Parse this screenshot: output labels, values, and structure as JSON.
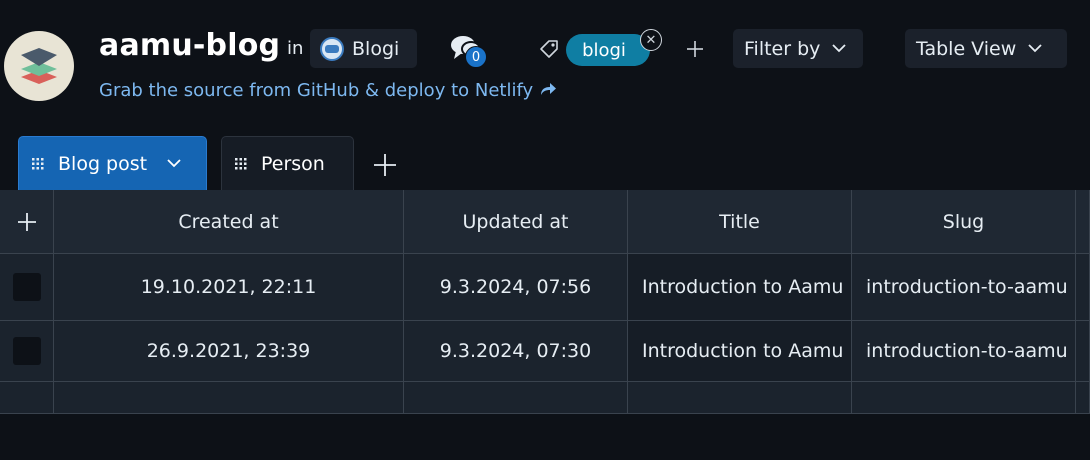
{
  "header": {
    "title": "aamu-blog",
    "in_label": "in",
    "org_name": "Blogi",
    "subtitle": "Grab the source from GitHub & deploy to Netlify",
    "comment_count": "0",
    "tag_label": "blogi",
    "filter_label": "Filter by",
    "view_label": "Table View"
  },
  "tabs": [
    {
      "label": "Blog post",
      "active": true
    },
    {
      "label": "Person",
      "active": false
    }
  ],
  "table": {
    "columns": [
      "",
      "Created at",
      "Updated at",
      "Title",
      "Slug"
    ],
    "rows": [
      {
        "created_at": "19.10.2021, 22:11",
        "updated_at": "9.3.2024, 07:56",
        "title": "Introduction to Aamu",
        "slug": "introduction-to-aamu"
      },
      {
        "created_at": "26.9.2021, 23:39",
        "updated_at": "9.3.2024, 07:30",
        "title": "Introduction to Aamu",
        "slug": "introduction-to-aamu"
      }
    ]
  },
  "colors": {
    "background": "#0d1117",
    "active_tab": "#1565b3",
    "tag_chip": "#0f7ea3",
    "badge": "#1a73c9",
    "link": "#7db8f0"
  }
}
